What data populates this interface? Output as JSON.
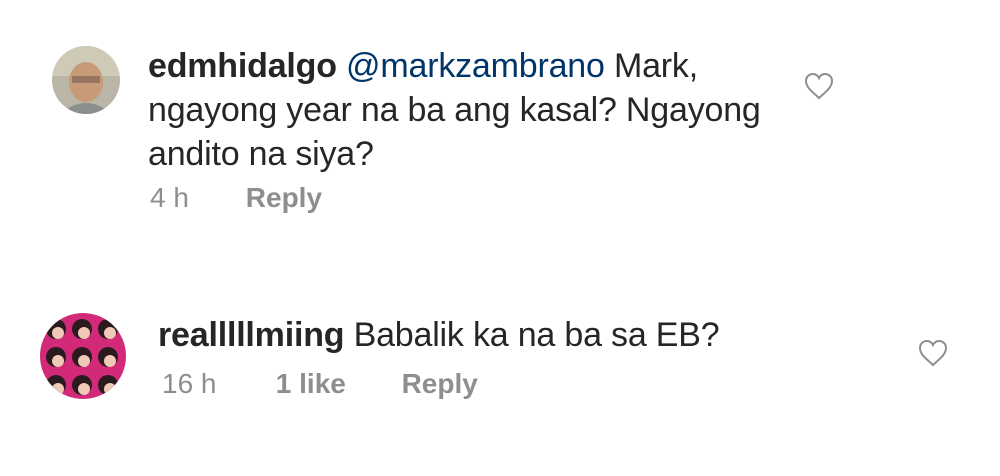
{
  "comments": [
    {
      "username": "edmhidalgo",
      "mention": "@markzambrano",
      "text_line1": " Mark,",
      "text_line2": "ngayong year na ba ang kasal? Ngayong",
      "text_line3": "andito na siya?",
      "time": "4 h",
      "likes": "",
      "reply_label": "Reply",
      "avatar": "avatar-photo",
      "like_icon": "heart-outline-icon"
    },
    {
      "username": "realllllmiing",
      "text": " Babalik ka na ba sa EB?",
      "time": "16 h",
      "likes": "1 like",
      "reply_label": "Reply",
      "avatar": "avatar-photo",
      "like_icon": "heart-outline-icon"
    }
  ]
}
